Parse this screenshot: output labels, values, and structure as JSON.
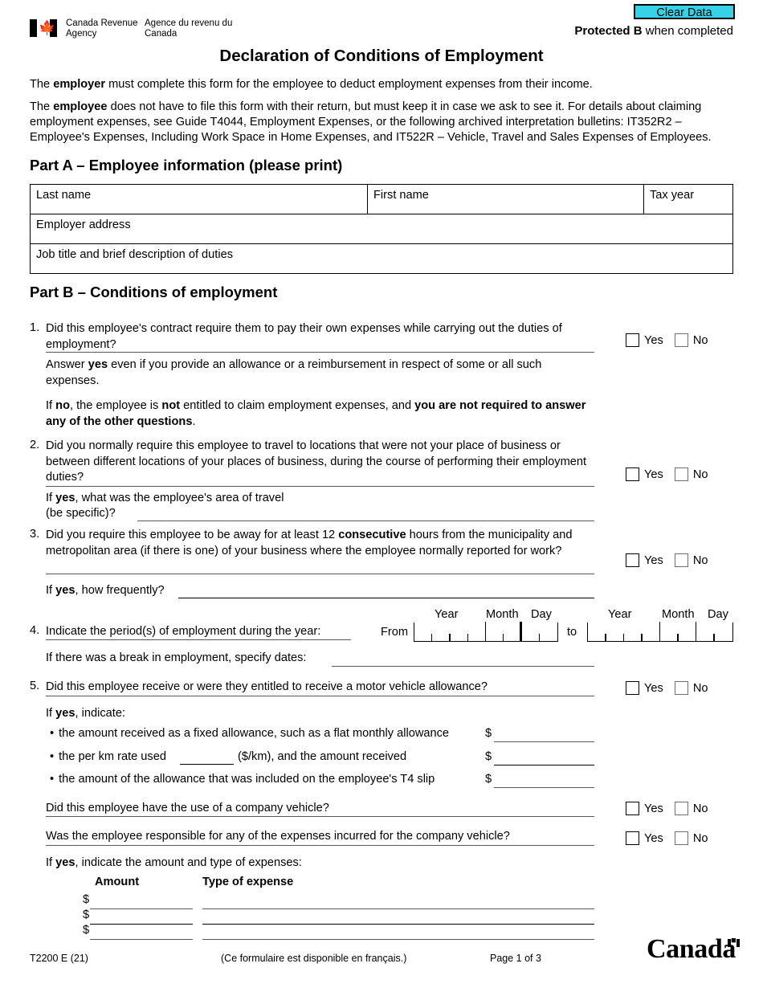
{
  "header": {
    "clear_data_label": "Clear Data",
    "protected_prefix": "Protected B",
    "protected_suffix": " when completed",
    "agency_en": "Canada Revenue Agency",
    "agency_fr": "Agence du revenu du Canada",
    "maple_leaf_icon": "maple-leaf-icon",
    "title": "Declaration of Conditions of Employment",
    "accent_color": "#35d2e8"
  },
  "intro": {
    "para1_pre": "The ",
    "para1_bold": "employer",
    "para1_post": " must complete this form for the employee to deduct employment expenses from their income.",
    "para2_pre": "The ",
    "para2_bold": "employee",
    "para2_post": " does not have to file this form with their return, but must keep it in case we ask to see it. For details about claiming employment expenses, see Guide T4044, Employment Expenses, or the following archived interpretation bulletins: IT352R2 – Employee's Expenses, Including Work Space in Home Expenses, and IT522R – Vehicle, Travel and Sales Expenses of Employees."
  },
  "partA": {
    "heading_label": "Part A",
    "heading_dash": " – ",
    "heading_rest": "Employee information (please print)",
    "fields": {
      "last_name": "Last name",
      "first_name": "First name",
      "tax_year": "Tax year",
      "employer_address": "Employer address",
      "job_title": "Job title and brief description of duties"
    }
  },
  "partB": {
    "heading_label": "Part B",
    "heading_dash": " – ",
    "heading_rest": "Conditions of employment",
    "yes_label": "Yes",
    "no_label": "No",
    "q1": {
      "num": "1.",
      "text_a": "Did this employee's contract require them to pay their own expenses while carrying out the duties of employment?",
      "note1_pre": "Answer ",
      "note1_bold": "yes",
      "note1_post": " even if you provide an allowance or a reimbursement in respect of some or all such expenses.",
      "note2_pre": "If ",
      "note2_b1": "no",
      "note2_mid1": ", the employee is ",
      "note2_b2": "not",
      "note2_mid2": " entitled to claim employment expenses, and ",
      "note2_b3": "you are not required to answer any of the other questions",
      "note2_end": "."
    },
    "q2": {
      "num": "2.",
      "text": "Did you normally require this employee to travel to locations that were not your place of business or between different locations of your places of business, during the course of performing their employment duties?",
      "sub_pre": "If ",
      "sub_bold": "yes",
      "sub_post": ", what was the employee's area of travel",
      "sub_line2": "(be specific)?"
    },
    "q3": {
      "num": "3.",
      "text_pre": "Did you require this employee to be away for at least 12 ",
      "text_bold": "consecutive",
      "text_post": " hours from the municipality and metropolitan area (if there is one) of your business where the employee normally reported for work?",
      "sub_pre": "If ",
      "sub_bold": "yes",
      "sub_post": ", how frequently?"
    },
    "q4": {
      "num": "4.",
      "text": "Indicate the period(s) of employment during the year:",
      "from_label": "From",
      "to_label": "to",
      "year_label": "Year",
      "month_label": "Month",
      "day_label": "Day",
      "break_text": "If there was a break in employment, specify dates:"
    },
    "q5": {
      "num": "5.",
      "text": "Did this employee receive or were they entitled to receive a motor vehicle allowance?",
      "sub_pre": "If ",
      "sub_bold": "yes",
      "sub_post": ", indicate:",
      "bullets": [
        "the amount received as a fixed allowance, such as a flat monthly allowance",
        "the amount of the allowance that was included on the employee's T4 slip"
      ],
      "bullet_km_a": "the per km rate used",
      "bullet_km_b": "($/km), and the amount received",
      "dollar_sign": "$",
      "company_vehicle_q": "Did this employee have the use of a company vehicle?",
      "company_vehicle_expenses_q": "Was the employee responsible for any of the expenses incurred for the company vehicle?",
      "expenses_intro_pre": "If ",
      "expenses_intro_bold": "yes",
      "expenses_intro_post": ", indicate the amount and type of expenses:",
      "expense_table": {
        "col_amount": "Amount",
        "col_type": "Type of expense",
        "rows": [
          "$",
          "$",
          "$"
        ]
      }
    }
  },
  "footer": {
    "form_code": "T2200 E (21)",
    "french_note": "(Ce formulaire est disponible en français.)",
    "page_number": "Page 1 of 3",
    "wordmark": "Canada"
  }
}
